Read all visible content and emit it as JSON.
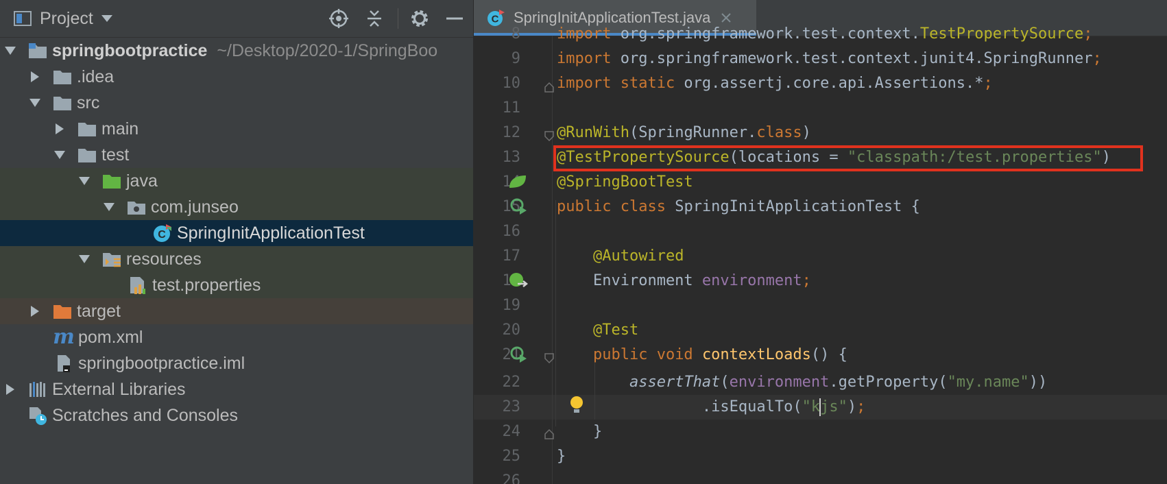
{
  "project_panel": {
    "title": "Project",
    "tree": [
      {
        "label": "springbootpractice",
        "path": "~/Desktop/2020-1/SpringBoo"
      },
      {
        "label": ".idea"
      },
      {
        "label": "src"
      },
      {
        "label": "main"
      },
      {
        "label": "test"
      },
      {
        "label": "java"
      },
      {
        "label": "com.junseo"
      },
      {
        "label": "SpringInitApplicationTest"
      },
      {
        "label": "resources"
      },
      {
        "label": "test.properties"
      },
      {
        "label": "target"
      },
      {
        "label": "pom.xml"
      },
      {
        "label": "springbootpractice.iml"
      },
      {
        "label": "External Libraries"
      },
      {
        "label": "Scratches and Consoles"
      }
    ]
  },
  "editor": {
    "tab_title": "SpringInitApplicationTest.java",
    "line_numbers": [
      "8",
      "9",
      "10",
      "11",
      "12",
      "13",
      "14",
      "15",
      "16",
      "17",
      "18",
      "19",
      "20",
      "21",
      "22",
      "23",
      "24",
      "25",
      "26"
    ],
    "highlighted_line": "13",
    "caret_line": "23"
  },
  "colors": {
    "accent": "#4a88c7",
    "highlight_box": "#e0321e",
    "selection": "#0d293e",
    "keyword": "#cc7832",
    "annotation": "#bbb529",
    "string": "#6a8759"
  }
}
